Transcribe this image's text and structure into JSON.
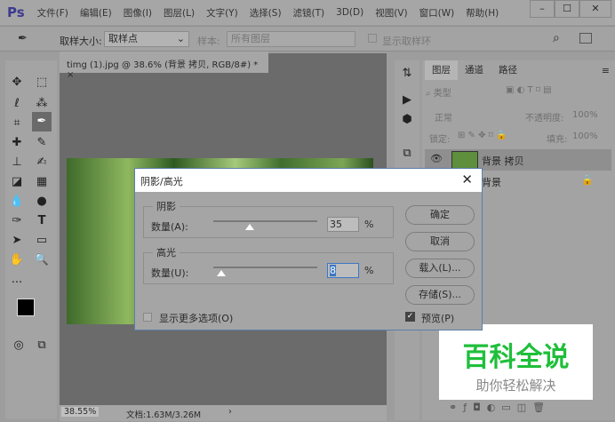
{
  "app": {
    "logo": "Ps",
    "menus": [
      "文件(F)",
      "编辑(E)",
      "图像(I)",
      "图层(L)",
      "文字(Y)",
      "选择(S)",
      "滤镜(T)",
      "3D(D)",
      "视图(V)",
      "窗口(W)",
      "帮助(H)"
    ],
    "window_buttons": [
      "–",
      "☐",
      "✕"
    ]
  },
  "options": {
    "sample_size_label": "取样大小:",
    "sample_size_value": "取样点",
    "sample_label": "样本:",
    "sample_value": "所有图层",
    "show_ring": "显示取样环"
  },
  "document": {
    "tab_title": "timg (1).jpg @ 38.6% (背景 拷贝, RGB/8#) *",
    "close": "×",
    "zoom": "38.55%",
    "doc_size": "文档:1.63M/3.26M",
    "arrow": "›"
  },
  "layers_panel": {
    "tabs": [
      "图层",
      "通道",
      "路径"
    ],
    "filter": "类型",
    "blend_mode": "正常",
    "opacity_label": "不透明度:",
    "opacity": "100%",
    "lock_label": "锁定:",
    "fill_label": "填充:",
    "fill": "100%",
    "layers": [
      {
        "name": "背景 拷贝",
        "selected": true
      },
      {
        "name": "背景",
        "locked": true
      }
    ]
  },
  "dialog": {
    "title": "阴影/高光",
    "shadows": {
      "label": "阴影",
      "amount_label": "数量(A):",
      "value": "35",
      "unit": "%",
      "slider_percent": 35
    },
    "highlights": {
      "label": "高光",
      "amount_label": "数量(U):",
      "value": "8",
      "unit": "%",
      "slider_percent": 8
    },
    "buttons": [
      "确定",
      "取消",
      "载入(L)...",
      "存储(S)..."
    ],
    "more_options": "显示更多选项(O)",
    "preview": "预览(P)",
    "preview_checked": true
  },
  "watermark": {
    "title": "百科全说",
    "subtitle": "助你轻松解决"
  }
}
